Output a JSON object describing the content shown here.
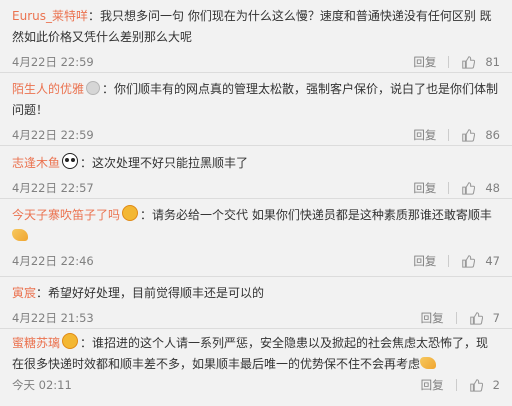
{
  "comments": [
    {
      "user": "Eurus_莱特咩",
      "text": "我只想多问一句 你们现在为什么这么慢？速度和普通快递没有任何区别 既然如此价格又凭什么差别那么大呢",
      "time": "4月22日 22:59",
      "reply": "回复",
      "likes": "81",
      "badge": "none"
    },
    {
      "user": "陌生人的优雅",
      "text": "你们顺丰有的网点真的管理太松散，强制客户保价，说白了也是你们体制问题！",
      "time": "4月22日 22:59",
      "reply": "回复",
      "likes": "86",
      "badge": "vip"
    },
    {
      "user": "志逢木鱼",
      "text": "这次处理不好只能拉黑顺丰了",
      "time": "4月22日 22:57",
      "reply": "回复",
      "likes": "48",
      "badge": "panda"
    },
    {
      "user": "今天子寨吹笛子了吗",
      "text": "请务必给一个交代 如果你们快递员都是这种素质那谁还敢寄顺丰",
      "time": "4月22日 22:46",
      "reply": "回复",
      "likes": "47",
      "badge": "gold"
    },
    {
      "user": "寅宸",
      "text": "希望好好处理，目前觉得顺丰还是可以的",
      "time": "4月22日 21:53",
      "reply": "回复",
      "likes": "7",
      "badge": "none"
    },
    {
      "user": "蜜糖苏璃",
      "text": "谁招进的这个人请一系列严惩，安全隐患以及掀起的社会焦虑太恐怖了，现在很多快递时效都和顺丰差不多，如果顺丰最后唯一的优势保不住不会再考虑",
      "time": "今天 02:11",
      "reply": "回复",
      "likes": "2",
      "badge": "gold"
    }
  ],
  "icons": {
    "like": "thumbs-up-icon",
    "clap": "clapping-hands-emoji"
  },
  "colors": {
    "username": "#eb7350",
    "text": "#333333",
    "meta": "#808080",
    "background": "#f2f2f2"
  }
}
